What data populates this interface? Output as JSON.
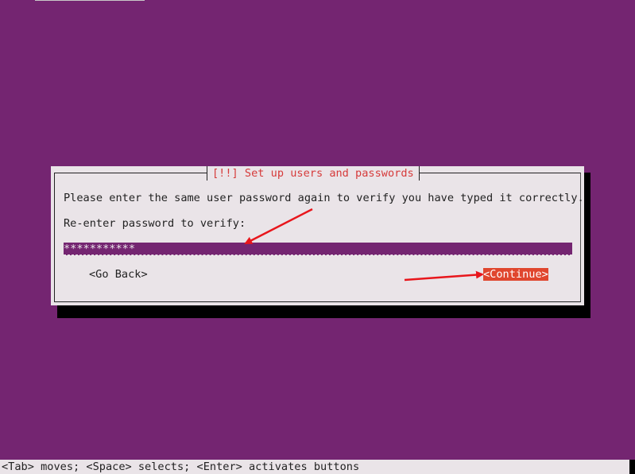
{
  "dialog": {
    "title": "[!!] Set up users and passwords",
    "message": "Please enter the same user password again to verify you have typed it correctly.",
    "field_label": "Re-enter password to verify:",
    "password_value": "***********",
    "back_label": "<Go Back>",
    "continue_label": "<Continue>"
  },
  "status_bar": {
    "text": "<Tab> moves; <Space> selects; <Enter> activates buttons"
  },
  "colors": {
    "background": "#742571",
    "dialog": "#eae4e8",
    "title_red": "#d63a3a",
    "button_selected": "#e0462e",
    "annotation_arrow": "#e8161c"
  },
  "annotations": {
    "arrows": [
      "arrow-to-password-field",
      "arrow-to-continue-button"
    ]
  }
}
